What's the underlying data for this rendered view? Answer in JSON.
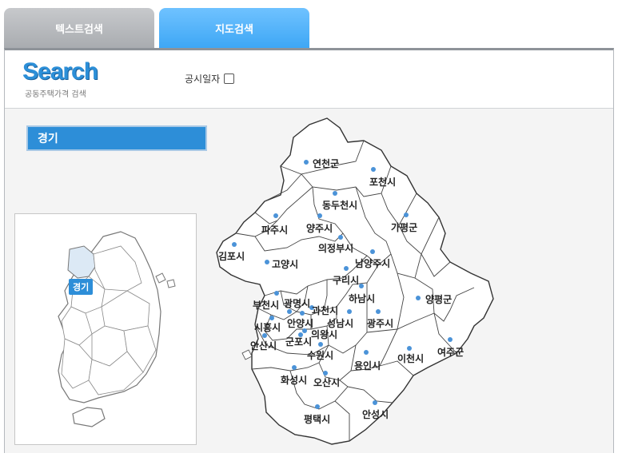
{
  "tabs": {
    "text_search": "텍스트검색",
    "map_search": "지도검색"
  },
  "header": {
    "logo": "Search",
    "subtitle": "공동주택가격 검색",
    "notice_label": "공시일자"
  },
  "region": {
    "selected": "경기"
  },
  "mini_map": {
    "label": "경기"
  },
  "cities": [
    "연천군",
    "포천시",
    "동두천시",
    "파주시",
    "양주시",
    "가평군",
    "의정부시",
    "김포시",
    "고양시",
    "남양주시",
    "구리시",
    "부천시",
    "광명시",
    "과천시",
    "하남시",
    "양평군",
    "시흥시",
    "안양시",
    "성남시",
    "광주시",
    "의왕시",
    "안산시",
    "군포시",
    "수원시",
    "이천시",
    "여주군",
    "용인시",
    "화성시",
    "오산시",
    "평택시",
    "안성시"
  ],
  "colors": {
    "accent": "#2d8ed8",
    "tab_active": "#3ea7f5",
    "tab_inactive": "#a9acb0",
    "dot": "#4b93d8"
  }
}
